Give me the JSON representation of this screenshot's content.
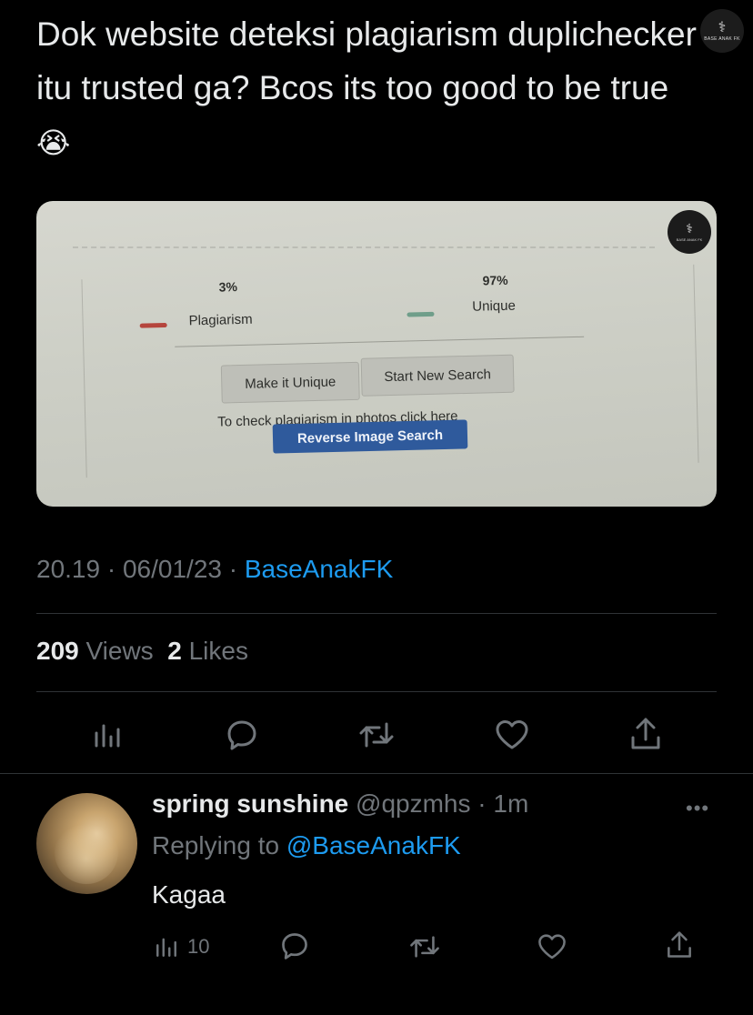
{
  "tweet": {
    "text": "Dok website deteksi plagiarism duplichecker itu trusted ga? Bcos its too good to be true",
    "emoji": "😭",
    "watermark_logo_text": "BASE ANAK FK",
    "photo": {
      "plagiarism_percent": "3%",
      "plagiarism_label": "Plagiarism",
      "unique_percent": "97%",
      "unique_label": "Unique",
      "make_unique_button": "Make it Unique",
      "new_search_button": "Start New Search",
      "hint_text": "To check plagiarism in photos click here",
      "reverse_search_button": "Reverse Image Search",
      "colors": {
        "plagiarism": "#b5453d",
        "unique": "#6f9e8a",
        "blue_button": "#2f5a9c"
      }
    },
    "time": "20.19",
    "date": "06/01/23",
    "source": "BaseAnakFK",
    "views_count": "209",
    "views_label": "Views",
    "likes_count": "2",
    "likes_label": "Likes"
  },
  "actions": [
    "analytics-icon",
    "reply-icon",
    "retweet-icon",
    "like-icon",
    "share-icon"
  ],
  "reply": {
    "display_name": "spring sunshine",
    "handle": "@qpzmhs",
    "time": "1m",
    "replying_prefix": "Replying to",
    "replying_handle": "@BaseAnakFK",
    "text": "Kagaa",
    "views_count": "10"
  },
  "colors": {
    "background": "#000000",
    "text": "#e7e9ea",
    "muted": "#71767b",
    "link": "#1d9bf0",
    "divider": "#2f3336"
  }
}
